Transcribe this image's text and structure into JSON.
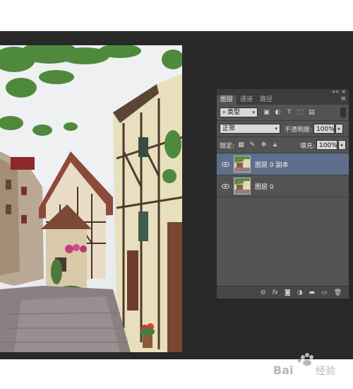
{
  "panel": {
    "tabs": [
      {
        "label": "图层",
        "active": true
      },
      {
        "label": "通道",
        "active": false
      },
      {
        "label": "路径",
        "active": false
      }
    ],
    "collapse_glyph": "««",
    "close_glyph": "×",
    "filter": {
      "label": "类型"
    },
    "blend_mode": "正常",
    "opacity_label": "不透明度:",
    "opacity_value": "100%",
    "lock_label": "锁定:",
    "fill_label": "填充:",
    "fill_value": "100%",
    "layers": [
      {
        "name": "图层 0 副本",
        "selected": true
      },
      {
        "name": "图层 0",
        "selected": false
      }
    ],
    "bottom_icons": [
      "link-icon",
      "fx-icon",
      "mask-icon",
      "adjustment-icon",
      "group-folder-icon",
      "new-layer-icon",
      "trash-icon"
    ]
  },
  "watermark": {
    "text_left": "Bai",
    "text_right": "经验"
  },
  "colors": {
    "workspace": "#282828",
    "panel": "#535353",
    "selected_layer": "#5f6f8b"
  }
}
